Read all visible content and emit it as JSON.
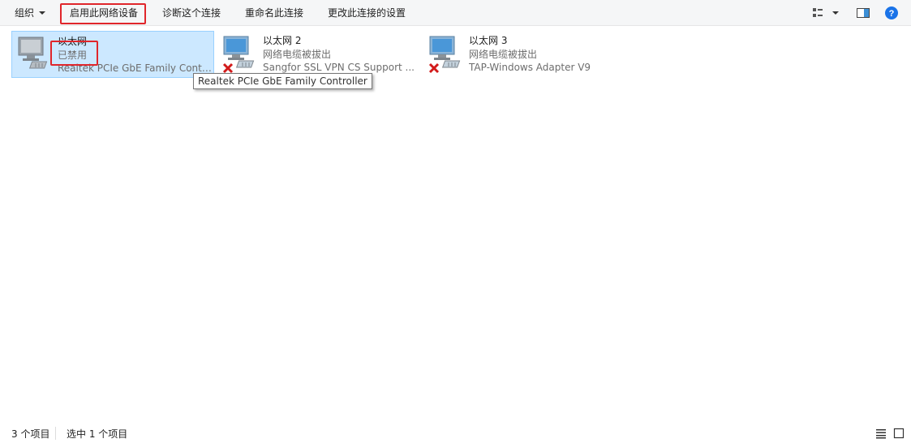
{
  "toolbar": {
    "organize": "组织",
    "enable": "启用此网络设备",
    "diagnose": "诊断这个连接",
    "rename": "重命名此连接",
    "change_settings": "更改此连接的设置"
  },
  "connections": [
    {
      "name": "以太网",
      "status": "已禁用",
      "device": "Realtek PCIe GbE Family Controller",
      "device_truncated": "Realtek PCIe GbE Family Contr...",
      "icon": "network-adapter-disabled-icon",
      "selected": true
    },
    {
      "name": "以太网 2",
      "status": "网络电缆被拔出",
      "device": "Sangfor SSL VPN CS Support ...",
      "icon": "network-adapter-unplugged-icon",
      "selected": false
    },
    {
      "name": "以太网 3",
      "status": "网络电缆被拔出",
      "device": "TAP-Windows Adapter V9",
      "icon": "network-adapter-unplugged-icon",
      "selected": false
    }
  ],
  "tooltip": "Realtek PCIe GbE Family Controller",
  "statusbar": {
    "count": "3 个项目",
    "selected": "选中 1 个项目"
  },
  "colors": {
    "selection_bg": "#cce8ff",
    "selection_border": "#99d1ff",
    "highlight_red": "#e0262b",
    "help_blue": "#1a73e8"
  }
}
